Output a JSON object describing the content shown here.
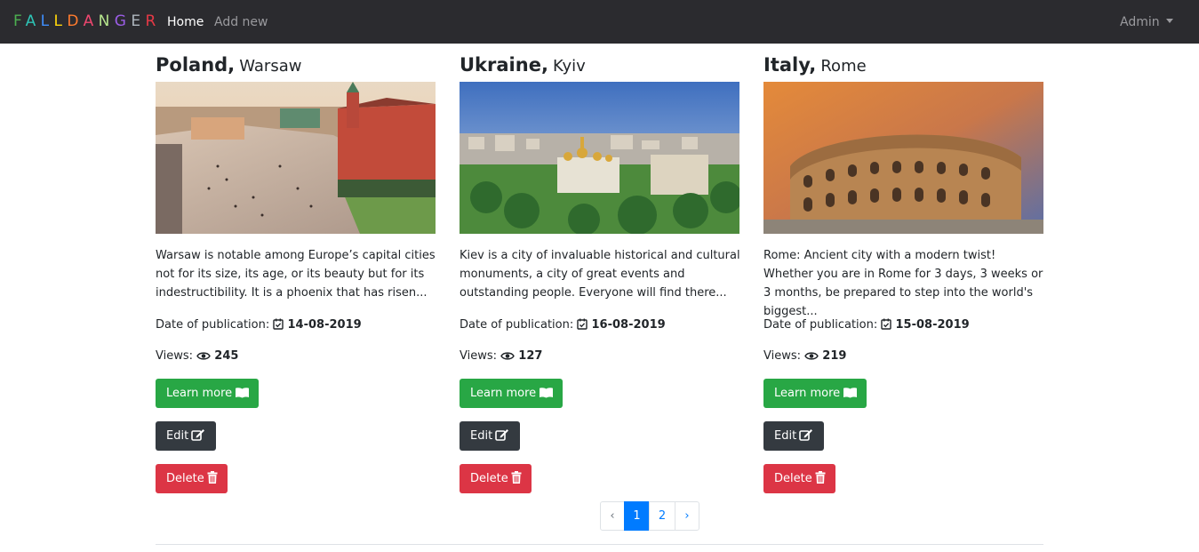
{
  "navbar": {
    "brand_letters": [
      {
        "ch": "F",
        "color": "#4caf50"
      },
      {
        "ch": "A",
        "color": "#2ec4b6"
      },
      {
        "ch": "L",
        "color": "#3f8efc"
      },
      {
        "ch": "L",
        "color": "#ffd60a"
      },
      {
        "ch": "D",
        "color": "#ff7b2e"
      },
      {
        "ch": "A",
        "color": "#ef476f"
      },
      {
        "ch": "N",
        "color": "#b5e48c"
      },
      {
        "ch": "G",
        "color": "#9b5de5"
      },
      {
        "ch": "E",
        "color": "#adb5bd"
      },
      {
        "ch": "R",
        "color": "#e63946"
      }
    ],
    "home": "Home",
    "add_new": "Add new",
    "admin": "Admin"
  },
  "labels": {
    "date_prefix": "Date of publication:",
    "views_prefix": "Views:",
    "learn_more": "Learn more",
    "edit": "Edit",
    "delete": "Delete"
  },
  "cards": [
    {
      "country": "Poland",
      "city": "Warsaw",
      "description": "Warsaw is notable among Europe’s capital cities not for its size, its age, or its beauty but for its indestructibility. It is a phoenix that has risen...",
      "date": "14-08-2019",
      "views": "245"
    },
    {
      "country": "Ukraine",
      "city": "Kyiv",
      "description": "Kiev is a city of invaluable historical and cultural monuments, a city of great events and outstanding people. Everyone will find there...",
      "date": "16-08-2019",
      "views": "127"
    },
    {
      "country": "Italy",
      "city": "Rome",
      "description": "Rome: Ancient city with a modern twist! Whether you are in Rome for 3 days, 3 weeks or 3 months, be prepared to step into the world's biggest...",
      "date": "15-08-2019",
      "views": "219"
    }
  ],
  "pagination": {
    "prev": "‹",
    "pages": [
      "1",
      "2"
    ],
    "active_page": "1",
    "next": "›"
  },
  "colors": {
    "navbar_bg": "#2b2b2f",
    "learn_more": "#28a745",
    "edit": "#343a40",
    "delete": "#dc3545",
    "active_page": "#007bff"
  }
}
